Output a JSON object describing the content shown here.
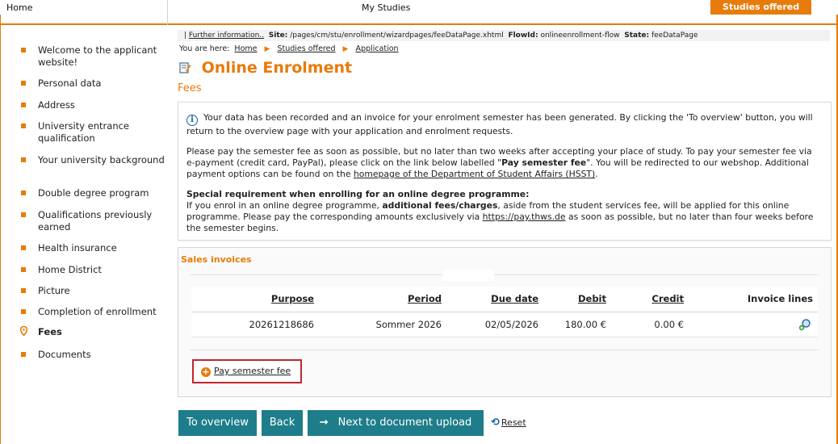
{
  "topbar": {
    "home": "Home",
    "my_studies": "My Studies",
    "studies_offered": "Studies offered",
    "accent": "#e77b0b"
  },
  "sidebar": {
    "items": [
      {
        "label": "Welcome to the applicant website!",
        "icon": "bullet"
      },
      {
        "label": "Personal data",
        "icon": "bullet"
      },
      {
        "label": "Address",
        "icon": "bullet"
      },
      {
        "label": "University entrance qualification",
        "icon": "bullet"
      },
      {
        "label": "Your university background",
        "icon": "bullet"
      },
      {
        "label": "Double degree program",
        "icon": "bullet"
      },
      {
        "label": "Qualifications previously earned",
        "icon": "bullet"
      },
      {
        "label": "Health insurance",
        "icon": "bullet"
      },
      {
        "label": "Home District",
        "icon": "bullet"
      },
      {
        "label": "Picture",
        "icon": "bullet"
      },
      {
        "label": "Completion of enrollment",
        "icon": "bullet"
      },
      {
        "label": "Fees",
        "icon": "location-pin",
        "active": true
      },
      {
        "label": "Documents",
        "icon": "bullet"
      }
    ]
  },
  "info_strip": {
    "pipe": "|",
    "further_info": "Further information..",
    "site_label": "Site:",
    "site_value": "/pages/cm/stu/enrollment/wizardpages/feeDataPage.xhtml",
    "flowid_label": "FlowId:",
    "flowid_value": "onlineenrollment-flow",
    "state_label": "State:",
    "state_value": "feeDataPage"
  },
  "breadcrumb": {
    "prefix": "You are here:",
    "items": [
      "Home",
      "Studies offered",
      "Application"
    ]
  },
  "page": {
    "title": "Online Enrolment",
    "section": "Fees"
  },
  "message": {
    "p1": "Your data has been recorded and an invoice for your enrolment semester has been generated. By clicking the 'To overview' button, you will return to the overview page with your application and enrolment requests.",
    "p2_a": "Please pay the semester fee as soon as possible, but no later than two weeks after accepting your place of study. To pay your semester fee via e-payment (credit card, PayPal), please click on the link below labelled \"",
    "p2_bold": "Pay semester fee",
    "p2_b": "\". You will be redirected to our webshop. Additional payment options can be found on the ",
    "p2_link": "homepage of the Department of Student Affairs (HSST)",
    "p2_c": ".",
    "p3_heading": "Special requirement when enrolling for an online degree programme:",
    "p3_a": "If you enrol in an online degree programme, ",
    "p3_bold": "additional fees/charges",
    "p3_b": ", aside from the student services fee, will be applied for this online programme. Please pay the corresponding amounts exclusively via ",
    "p3_link": "https://pay.thws.de",
    "p3_c": " as soon as possible, but no later than four weeks before the semester begins."
  },
  "invoices": {
    "title": "Sales invoices",
    "columns": [
      "Purpose",
      "Period",
      "Due date",
      "Debit",
      "Credit",
      "Invoice lines"
    ],
    "rows": [
      {
        "purpose": "20261218686",
        "period": "Sommer 2026",
        "due_date": "02/05/2026",
        "debit": "180.00 €",
        "credit": "0.00 €",
        "invoice_lines_icon": "magnify-plus-icon"
      }
    ],
    "pay_button": "Pay semester fee"
  },
  "buttons": {
    "to_overview": "To overview",
    "back": "Back",
    "next": "Next to document upload",
    "next_arrow": "→",
    "reset": "Reset",
    "button_color": "#1e7d8a"
  }
}
